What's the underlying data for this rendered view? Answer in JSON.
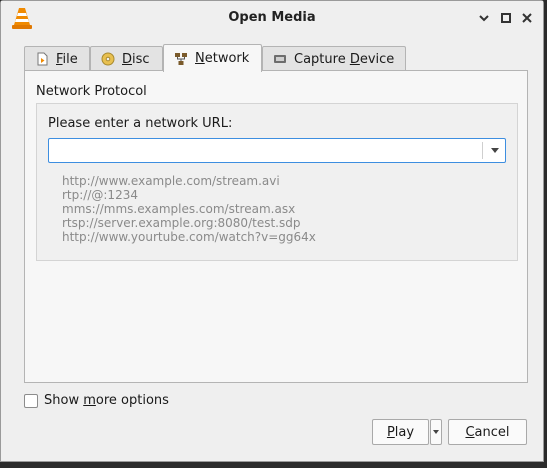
{
  "window": {
    "title": "Open Media"
  },
  "titlebar_buttons": [
    "chevron-down-icon",
    "maximize-icon",
    "close-icon"
  ],
  "tabs": [
    {
      "pre": "",
      "mn": "F",
      "post": "ile",
      "icon": "file-icon"
    },
    {
      "pre": "",
      "mn": "D",
      "post": "isc",
      "icon": "disc-icon"
    },
    {
      "pre": "",
      "mn": "N",
      "post": "etwork",
      "icon": "network-icon",
      "active": true
    },
    {
      "pre": "Capture ",
      "mn": "D",
      "post": "evice",
      "icon": "capture-device-icon"
    }
  ],
  "network": {
    "group_title": "Network Protocol",
    "url_label": "Please enter a network URL:",
    "url_value": "",
    "examples": [
      "http://www.example.com/stream.avi",
      "rtp://@:1234",
      "mms://mms.examples.com/stream.asx",
      "rtsp://server.example.org:8080/test.sdp",
      "http://www.yourtube.com/watch?v=gg64x"
    ]
  },
  "more_options": {
    "pre": "Show ",
    "mn": "m",
    "post": "ore options",
    "checked": false
  },
  "buttons": {
    "play": {
      "pre": "",
      "mn": "P",
      "post": "lay"
    },
    "cancel": {
      "pre": "",
      "mn": "C",
      "post": "ancel"
    }
  },
  "colors": {
    "accent": "#3d8ee0",
    "vlc_orange": "#f08a00"
  }
}
